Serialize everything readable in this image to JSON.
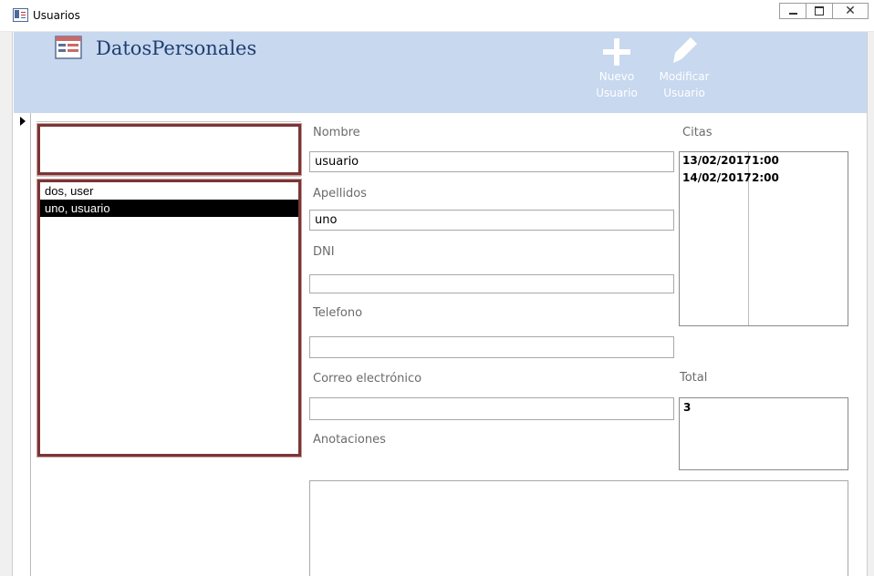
{
  "window": {
    "title": "Usuarios",
    "minimize_icon": "minimize-icon",
    "restore_icon": "restore-icon",
    "close_glyph": "✕"
  },
  "header": {
    "form_icon": "form-icon",
    "title": "DatosPersonales",
    "new_user": {
      "line1": "Nuevo",
      "line2": "Usuario",
      "icon": "plus-icon"
    },
    "edit_user": {
      "line1": "Modificar",
      "line2": "Usuario",
      "icon": "pencil-icon"
    }
  },
  "colors": {
    "header_bg": "#c7d8ef",
    "title_color": "#1f3e70",
    "list_border": "#7b3535"
  },
  "search": {
    "value": ""
  },
  "user_list": {
    "items": [
      "dos, user",
      "uno, usuario"
    ],
    "selected_index": 1
  },
  "fields": {
    "nombre": {
      "label": "Nombre",
      "value": "usuario"
    },
    "apellidos": {
      "label": "Apellidos",
      "value": "uno"
    },
    "dni": {
      "label": "DNI",
      "value": ""
    },
    "telefono": {
      "label": "Telefono",
      "value": ""
    },
    "correo": {
      "label": "Correo electrónico",
      "value": ""
    },
    "anotaciones": {
      "label": "Anotaciones",
      "value": ""
    }
  },
  "citas": {
    "label": "Citas",
    "rows": [
      {
        "date": "13/02/2017",
        "time": "1:00"
      },
      {
        "date": "14/02/2017",
        "time": "2:00"
      }
    ]
  },
  "total": {
    "label": "Total",
    "value": "3"
  }
}
